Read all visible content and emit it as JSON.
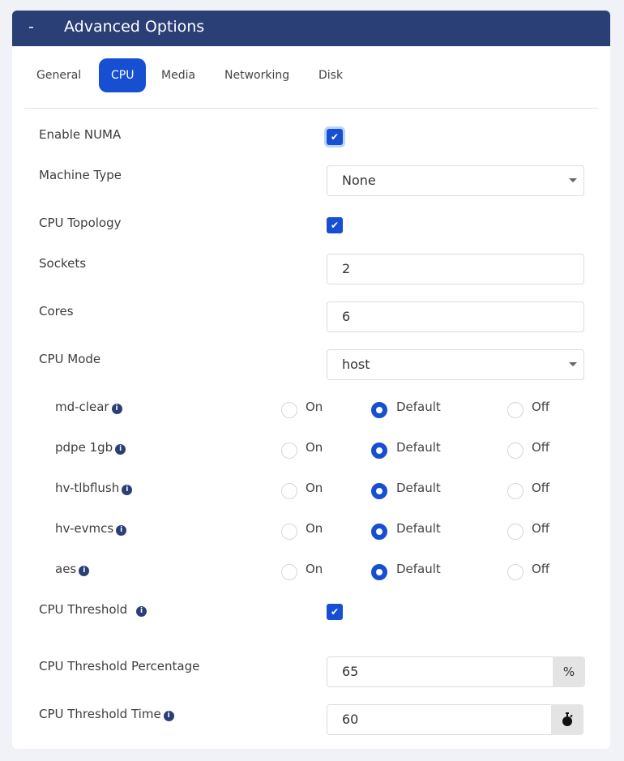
{
  "header": {
    "toggle": "-",
    "title": "Advanced Options"
  },
  "tabs": [
    {
      "label": "General"
    },
    {
      "label": "CPU",
      "active": true
    },
    {
      "label": "Media"
    },
    {
      "label": "Networking"
    },
    {
      "label": "Disk"
    }
  ],
  "fields": {
    "enable_numa": {
      "label": "Enable NUMA",
      "checked": true
    },
    "machine_type": {
      "label": "Machine Type",
      "value": "None"
    },
    "cpu_topology": {
      "label": "CPU Topology",
      "checked": true
    },
    "sockets": {
      "label": "Sockets",
      "value": "2"
    },
    "cores": {
      "label": "Cores",
      "value": "6"
    },
    "cpu_mode": {
      "label": "CPU Mode",
      "value": "host"
    },
    "cpu_threshold": {
      "label": "CPU Threshold",
      "checked": true
    },
    "cpu_threshold_percentage": {
      "label": "CPU Threshold Percentage",
      "value": "65",
      "addon": "%"
    },
    "cpu_threshold_time": {
      "label": "CPU Threshold Time",
      "value": "60",
      "addon_icon": "stopwatch-icon"
    }
  },
  "radio_options": {
    "on": "On",
    "default": "Default",
    "off": "Off"
  },
  "flags": [
    {
      "name": "md-clear",
      "selected": "Default"
    },
    {
      "name": "pdpe 1gb",
      "selected": "Default"
    },
    {
      "name": "hv-tlbflush",
      "selected": "Default"
    },
    {
      "name": "hv-evmcs",
      "selected": "Default"
    },
    {
      "name": "aes",
      "selected": "Default"
    }
  ],
  "colors": {
    "header": "#2a3f76",
    "accent": "#174fd3"
  }
}
